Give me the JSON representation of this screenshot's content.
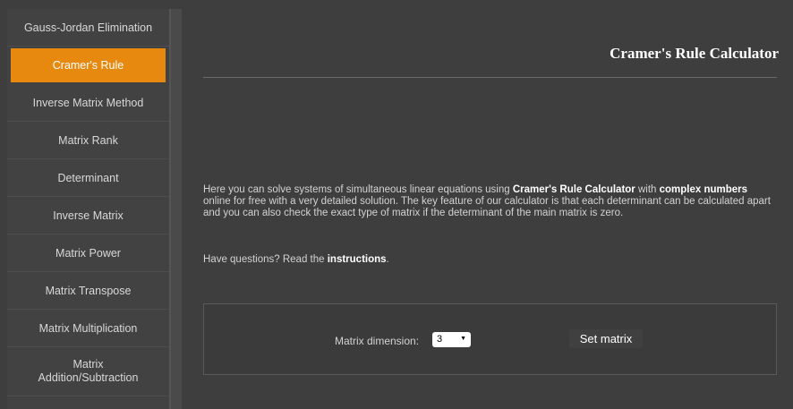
{
  "sidebar": {
    "items": [
      {
        "label": "Gauss-Jordan Elimination"
      },
      {
        "label": "Cramer's Rule"
      },
      {
        "label": "Inverse Matrix Method"
      },
      {
        "label": "Matrix Rank"
      },
      {
        "label": "Determinant"
      },
      {
        "label": "Inverse Matrix"
      },
      {
        "label": "Matrix Power"
      },
      {
        "label": "Matrix Transpose"
      },
      {
        "label": "Matrix Multiplication"
      },
      {
        "label": "Matrix Addition/Subtraction"
      }
    ]
  },
  "main": {
    "title": "Cramer's Rule Calculator",
    "description": {
      "part1": "Here you can solve systems of simultaneous linear equations using ",
      "bold1": "Cramer's Rule Calculator",
      "part2": " with ",
      "bold2": "complex numbers",
      "part3": " online for free with a very detailed solution. The key feature of our calculator is that each determinant can be calculated apart and you can also check the exact type of matrix if the determinant of the main matrix is zero."
    },
    "questions": {
      "prefix": "Have questions? Read the ",
      "link": "instructions",
      "suffix": "."
    },
    "panel": {
      "dimension_label": "Matrix dimension:",
      "dimension_value": "3",
      "set_button": "Set matrix"
    }
  },
  "colors": {
    "active_item": "#e8890f",
    "background": "#3e3e3e",
    "sidebar": "#424242"
  }
}
